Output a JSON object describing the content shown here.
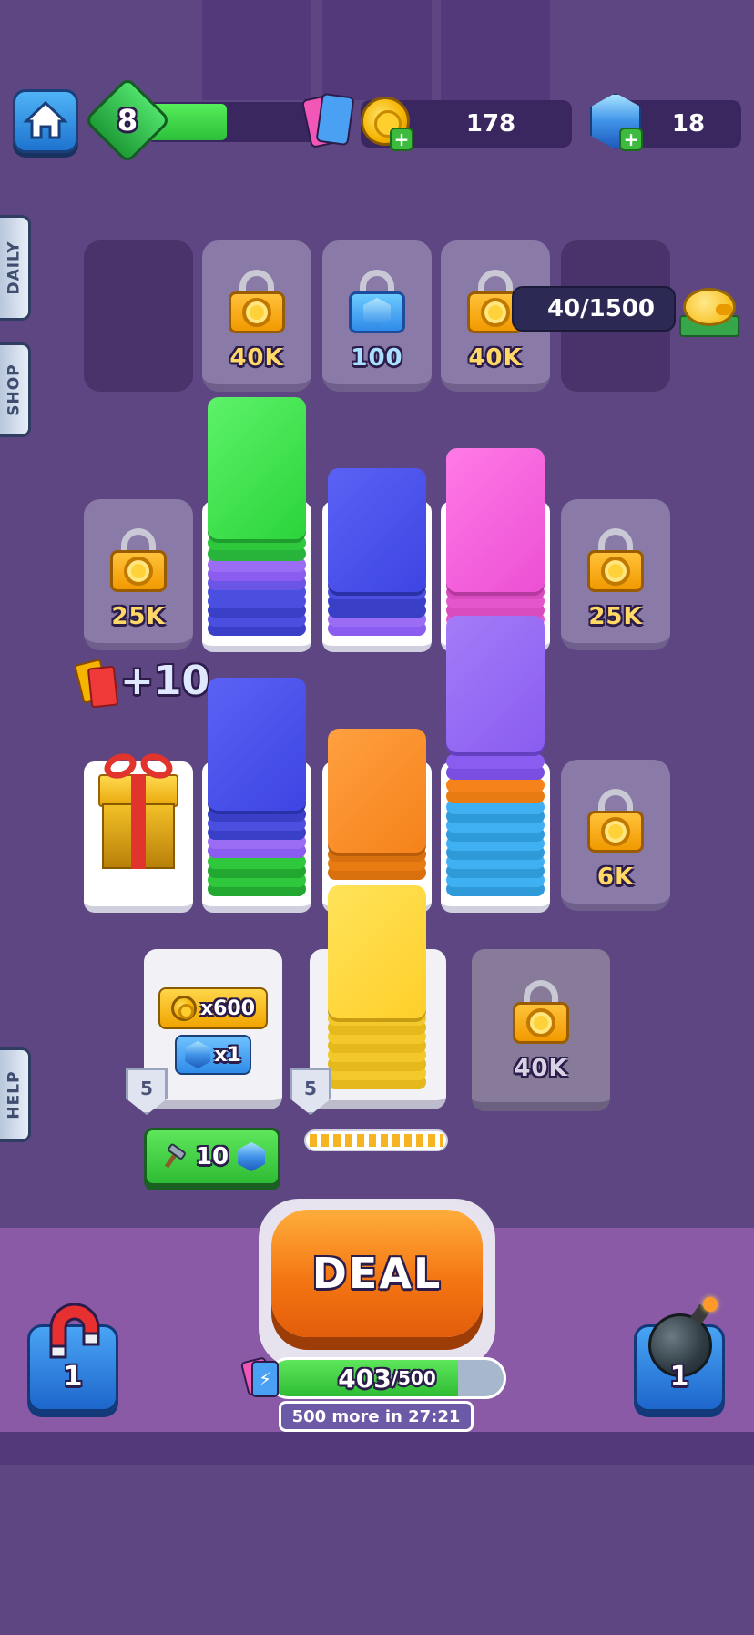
{
  "hud": {
    "level": "8",
    "level_progress": 0.38,
    "coins": "178",
    "gems": "18"
  },
  "side_tabs": {
    "daily": "DAILY",
    "shop": "SHOP",
    "help": "HELP"
  },
  "piggy_bank": {
    "progress_text": "40/1500"
  },
  "locked_slots": {
    "top_1": "40K",
    "top_2": "100",
    "top_3": "40K",
    "mid_left": "25K",
    "mid_right": "25K",
    "low_right": "6K",
    "bottom_right": "40K"
  },
  "bonus": {
    "cards_reward": "+10"
  },
  "reward_slot": {
    "coins": "x600",
    "gems": "x1",
    "badge_left": "5",
    "badge_right": "5"
  },
  "hammer": {
    "cost": "10"
  },
  "deal": {
    "label": "DEAL",
    "energy_current": "403",
    "energy_max": "/500",
    "refill_text": "500 more in 27:21",
    "energy_fraction": 0.806
  },
  "boosters": {
    "magnet_count": "1",
    "bomb_count": "1"
  },
  "colors": {
    "green": "#2fe03a",
    "blue": "#3f46e6",
    "purple": "#8a5cf0",
    "pink": "#f05ad8",
    "orange": "#f88a1a",
    "yellow": "#ffd52e",
    "light_blue": "#3fb0f2"
  }
}
